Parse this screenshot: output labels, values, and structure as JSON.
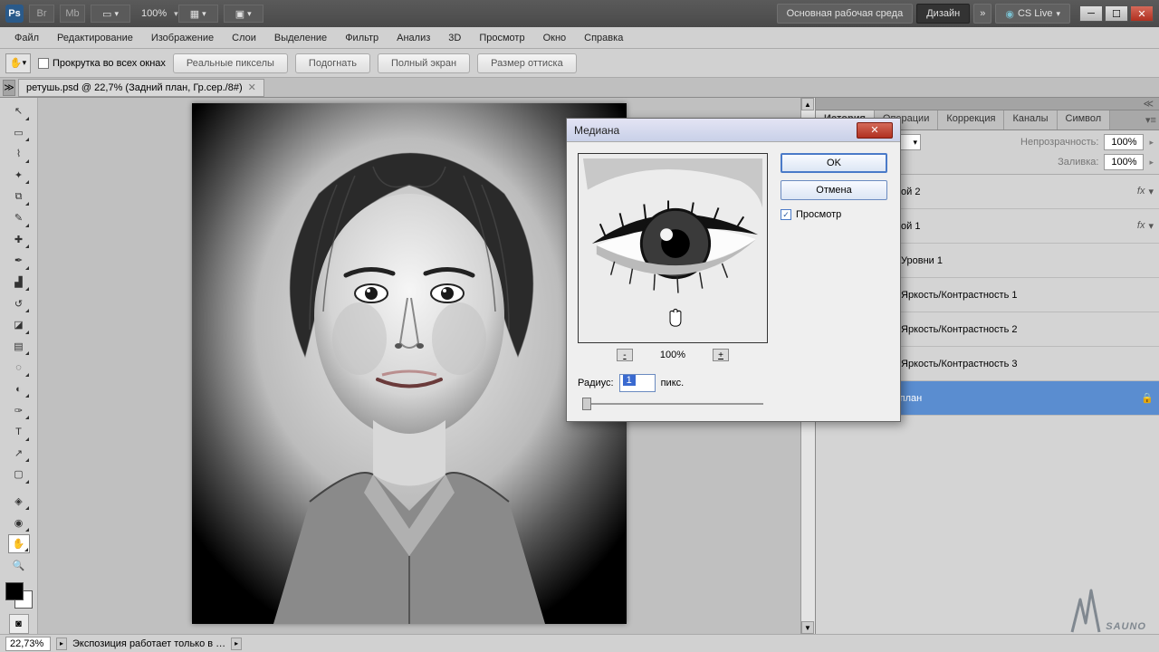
{
  "titlebar": {
    "zoom": "100%",
    "workspace_label": "Основная рабочая среда",
    "design_label": "Дизайн",
    "cslive_label": "CS Live"
  },
  "menu": [
    "Файл",
    "Редактирование",
    "Изображение",
    "Слои",
    "Выделение",
    "Фильтр",
    "Анализ",
    "3D",
    "Просмотр",
    "Окно",
    "Справка"
  ],
  "options": {
    "scroll_all": "Прокрутка во всех окнах",
    "btns": [
      "Реальные пикселы",
      "Подогнать",
      "Полный экран",
      "Размер оттиска"
    ]
  },
  "doc_tab": "ретушь.psd @ 22,7% (Задний план, Гр.сер./8#)",
  "panels": {
    "tabs": [
      "История",
      "Операции",
      "Коррекция",
      "Каналы",
      "Символ"
    ],
    "opacity_label": "Непрозрачность:",
    "opacity_val": "100%",
    "fill_label": "Заливка:",
    "fill_val": "100%"
  },
  "layers": [
    {
      "name": "ой 2",
      "fx": true
    },
    {
      "name": "ой 1",
      "fx": true
    },
    {
      "name": "Уровни 1"
    },
    {
      "name": "Яркость/Контрастность 1"
    },
    {
      "name": "Яркость/Контрастность 2",
      "dark": true
    },
    {
      "name": "Яркость/Контрастность 3",
      "dark": true
    },
    {
      "name": "здний план",
      "selected": true,
      "lock": true
    }
  ],
  "dialog": {
    "title": "Медиана",
    "ok": "OK",
    "cancel": "Отмена",
    "preview": "Просмотр",
    "zoom": "100%",
    "radius_label": "Радиус:",
    "radius_val": "1",
    "radius_unit": "пикс."
  },
  "status": {
    "zoom": "22,73%",
    "info": "Экспозиция работает только в …"
  },
  "watermark": "SAUNO"
}
